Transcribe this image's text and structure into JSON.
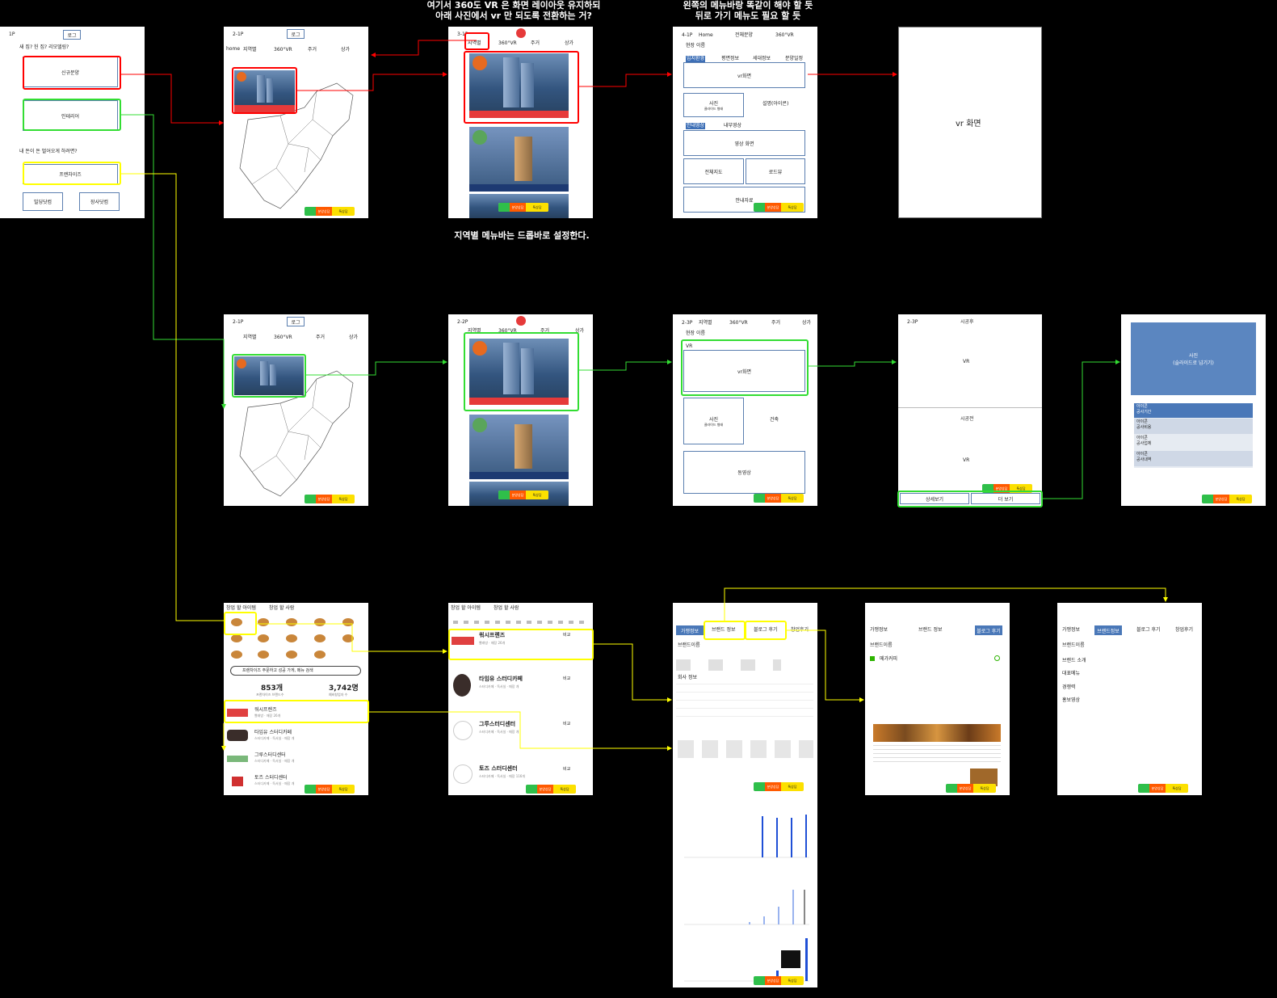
{
  "notes": {
    "vr_top": [
      "여기서 360도 VR 은 화면 레이아웃 유지하되",
      "아래 사진에서 vr 만 되도록 전환하는 거?"
    ],
    "menu_top": [
      "왼쪽의 메뉴바랑 똑같이 해야 할 듯",
      "뒤로 가기 메뉴도 필요 할 듯"
    ],
    "dropbar": "지역별 메뉴바는 드롭바로 설정한다."
  },
  "s1": {
    "page": "1P",
    "login": "로그",
    "q1": "새 집? 헌 집? 리모델링?",
    "new_sale": "신규분양",
    "interior": "인테리어",
    "q2": "내 돈이 돈 벌어오게 하려면?",
    "franchise": "프랜차이즈",
    "building": "빌딩닷컴",
    "shop": "장사닷컴"
  },
  "nav": {
    "region": "지역별",
    "vr": "360°VR",
    "house": "주거",
    "shop": "상가",
    "home": "home"
  },
  "s2": {
    "page": "2-1P",
    "login": "로그"
  },
  "s3": {
    "page": "3-1P"
  },
  "s4": {
    "page": "4-1P",
    "home": "Home",
    "all_sale": "전체분양",
    "vr": "360°VR",
    "site_name": "현장 이름",
    "vr_screen": "vr화면",
    "photo": "사진",
    "photo_sub": "클라이드 형태",
    "desc_icon": "설명(아이콘)",
    "guide_video": "안내영상",
    "inner_video": "내부영상",
    "video_screen": "영상 화면",
    "full_map": "전체지도",
    "road_view": "로드뷰",
    "guide_doc": "안내자료",
    "tabs": [
      "입지환경",
      "평면정보",
      "세대정보",
      "분양일정"
    ]
  },
  "s5": {
    "vr_screen": "vr 화면"
  },
  "r2_s1": {
    "page": "2-1P",
    "login": "로그"
  },
  "r2_s2": {
    "page": "2-2P"
  },
  "r2_s3": {
    "page": "2-3P",
    "region": "지역별",
    "vr": "360°VR",
    "house": "주거",
    "shop": "상가",
    "site_name": "현장 이름",
    "vr_label": "VR",
    "vr_screen": "vr화면",
    "photo": "사진",
    "photo_sub": "클라이드 형태",
    "building": "건축",
    "drone": "동영상"
  },
  "r2_s4": {
    "page": "2-3P",
    "after": "시공후",
    "vr1": "VR",
    "before": "시공전",
    "vr2": "VR",
    "detail": "상세보기",
    "more": "더 보기"
  },
  "r2_s5": {
    "photo": "사진",
    "photo_sub": "(슬라이드로 넘기기)",
    "rows": [
      [
        "아이콘",
        "공사기간"
      ],
      [
        "아이콘",
        "공사비용"
      ],
      [
        "아이콘",
        "공사업체"
      ],
      [
        "아이콘",
        "공사내역"
      ]
    ]
  },
  "r3_s1": {
    "tab1": "창업 할 아이템",
    "tab2": "창업 할 사람",
    "search": "프랜차이즈 주문하고 성공 가게, 메뉴 검색",
    "stat1_value": "853개",
    "stat1_label": "프랜차이즈 브랜드수",
    "stat2_value": "3,742명",
    "stat2_label": "예비창업자 수",
    "items": [
      {
        "name": "워시프렌즈",
        "sub": "빨래방 · 매장 26개"
      },
      {
        "name": "타임유 스터디카페",
        "sub": "스터디카페 · 독서실 · 매장 개"
      },
      {
        "name": "그루스터디센터",
        "sub": "스터디카페 · 독서실 · 매장 개"
      },
      {
        "name": "토즈 스터디센터",
        "sub": "스터디카페 · 독서실 · 매장 개"
      }
    ]
  },
  "r3_s2": {
    "tab1": "창업 할 아이템",
    "tab2": "창업 할 사람",
    "items": [
      {
        "name": "워시프렌즈",
        "sub": "빨래방 · 매장 26개"
      },
      {
        "name": "타임유 스터디카페",
        "sub": "스터디카페 · 독서실 · 매장 개"
      },
      {
        "name": "그루스터디센터",
        "sub": "스터디카페 · 독서실 · 매장 개"
      },
      {
        "name": "토즈 스터디센터",
        "sub": "스터디카페 · 독서실 · 매장 116개"
      }
    ],
    "compare": "비교"
  },
  "r3_s3": {
    "tab_shop": "가맹정보",
    "tab_brand": "브랜드 정보",
    "tab_blog": "블로그 후기",
    "tab_review": "창업후기",
    "brand_name": "브랜드이름",
    "company": "회사 정보"
  },
  "r3_s4": {
    "tab_shop": "가맹정보",
    "tab_brand": "브랜드 정보",
    "tab_blog": "블로그 후기",
    "brand_name": "브랜드이름",
    "blog_title": "메가커피"
  },
  "r3_s5": {
    "tab_shop": "가맹정보",
    "tab_brand": "브랜드정보",
    "tab_blog": "블로그 후기",
    "tab_review": "창업후기",
    "brand_name": "브랜드이름",
    "intro": "브랜드 소개",
    "menu": "대표메뉴",
    "competitor": "경쟁력",
    "promo": "홍보영상"
  },
  "bottom_bar": {
    "go": "분양상담",
    "talk": "톡상담"
  },
  "colors": {
    "red": "#ff0000",
    "green": "#33dd33",
    "yellow": "#ffff00",
    "box": "#5b7fb0"
  }
}
